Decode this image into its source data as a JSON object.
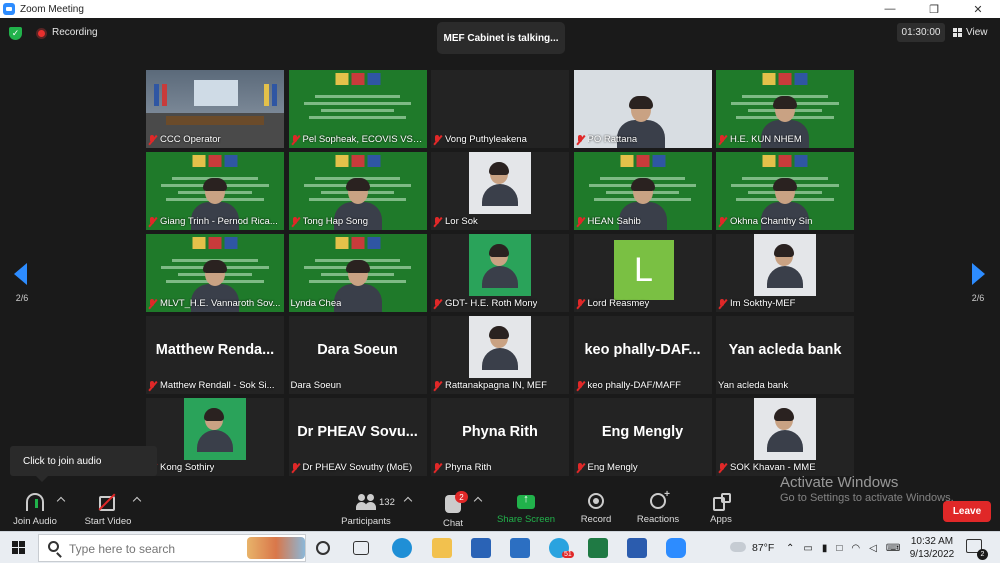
{
  "window": {
    "title": "Zoom Meeting",
    "minimize": "—",
    "restore": "❐",
    "close": "✕"
  },
  "topbar": {
    "recording_label": "Recording",
    "talking_text": "MEF Cabinet is talking...",
    "timer": "01:30:00",
    "view_label": "View"
  },
  "pager": {
    "left": "2/6",
    "right": "2/6"
  },
  "tiles": [
    {
      "name": "CCC Operator",
      "kind": "room",
      "muted": true
    },
    {
      "name": "Pel Sopheak, ECOVIS VSDK",
      "kind": "banner",
      "muted": true
    },
    {
      "name": "Vong Puthyleakena",
      "kind": "blank",
      "muted": true
    },
    {
      "name": "PO Rattana",
      "kind": "person-light",
      "muted": true
    },
    {
      "name": "H.E. KUN NHEM",
      "kind": "banner-person",
      "muted": true
    },
    {
      "name": "Giang Trinh - Pernod Rica...",
      "kind": "banner-person",
      "muted": true
    },
    {
      "name": "Tong Hap Song",
      "kind": "banner-person",
      "muted": true
    },
    {
      "name": "Lor Sok",
      "kind": "photo",
      "muted": true
    },
    {
      "name": "HEAN Sahib",
      "kind": "banner-person",
      "muted": true
    },
    {
      "name": "Okhna Chanthy Sin",
      "kind": "banner-person",
      "muted": true
    },
    {
      "name": "MLVT_H.E. Vannaroth Sov...",
      "kind": "banner-person",
      "muted": true
    },
    {
      "name": "Lynda Chea",
      "kind": "banner-person",
      "muted": false
    },
    {
      "name": "GDT- H.E. Roth Mony",
      "kind": "photo-green",
      "muted": true
    },
    {
      "name": "Lord Reasmey",
      "kind": "letter",
      "letter": "L",
      "muted": true
    },
    {
      "name": "Im Sokthy-MEF",
      "kind": "photo",
      "muted": true
    },
    {
      "name": "Matthew Rendall - Sok Si...",
      "kind": "name",
      "display": "Matthew  Renda...",
      "muted": true
    },
    {
      "name": "Dara Soeun",
      "kind": "name",
      "display": "Dara Soeun",
      "muted": false
    },
    {
      "name": "Rattanakpagna IN, MEF",
      "kind": "photo",
      "muted": true
    },
    {
      "name": "keo phally-DAF/MAFF",
      "kind": "name",
      "display": "keo  phally-DAF...",
      "muted": true
    },
    {
      "name": "Yan acleda bank",
      "kind": "name",
      "display": "Yan acleda bank",
      "muted": false
    },
    {
      "name": "Kong Sothiry",
      "kind": "photo-green",
      "muted": true
    },
    {
      "name": "Dr PHEAV Sovuthy (MoE)",
      "kind": "name",
      "display": "Dr  PHEAV  Sovu...",
      "muted": true
    },
    {
      "name": "Phyna Rith",
      "kind": "name",
      "display": "Phyna Rith",
      "muted": true
    },
    {
      "name": "Eng Mengly",
      "kind": "name",
      "display": "Eng Mengly",
      "muted": true
    },
    {
      "name": "SOK Khavan - MME",
      "kind": "photo",
      "muted": true
    }
  ],
  "tooltip": {
    "text": "Click to join audio"
  },
  "toolbar": {
    "join_audio": "Join Audio",
    "start_video": "Start Video",
    "participants": "Participants",
    "participants_count": "132",
    "chat": "Chat",
    "chat_badge": "2",
    "share_screen": "Share Screen",
    "record": "Record",
    "reactions": "Reactions",
    "apps": "Apps",
    "leave": "Leave"
  },
  "watermark": {
    "line1": "Activate Windows",
    "line2": "Go to Settings to activate Windows."
  },
  "taskbar": {
    "search_placeholder": "Type here to search",
    "temperature": "87°F",
    "time": "10:32 AM",
    "date": "9/13/2022",
    "notification_count": "2",
    "telegram_badge": "51"
  },
  "colors": {
    "accent": "#2d8cff",
    "share_green": "#21b24b",
    "leave_red": "#e02828",
    "banner_green": "#1f7a2a"
  }
}
